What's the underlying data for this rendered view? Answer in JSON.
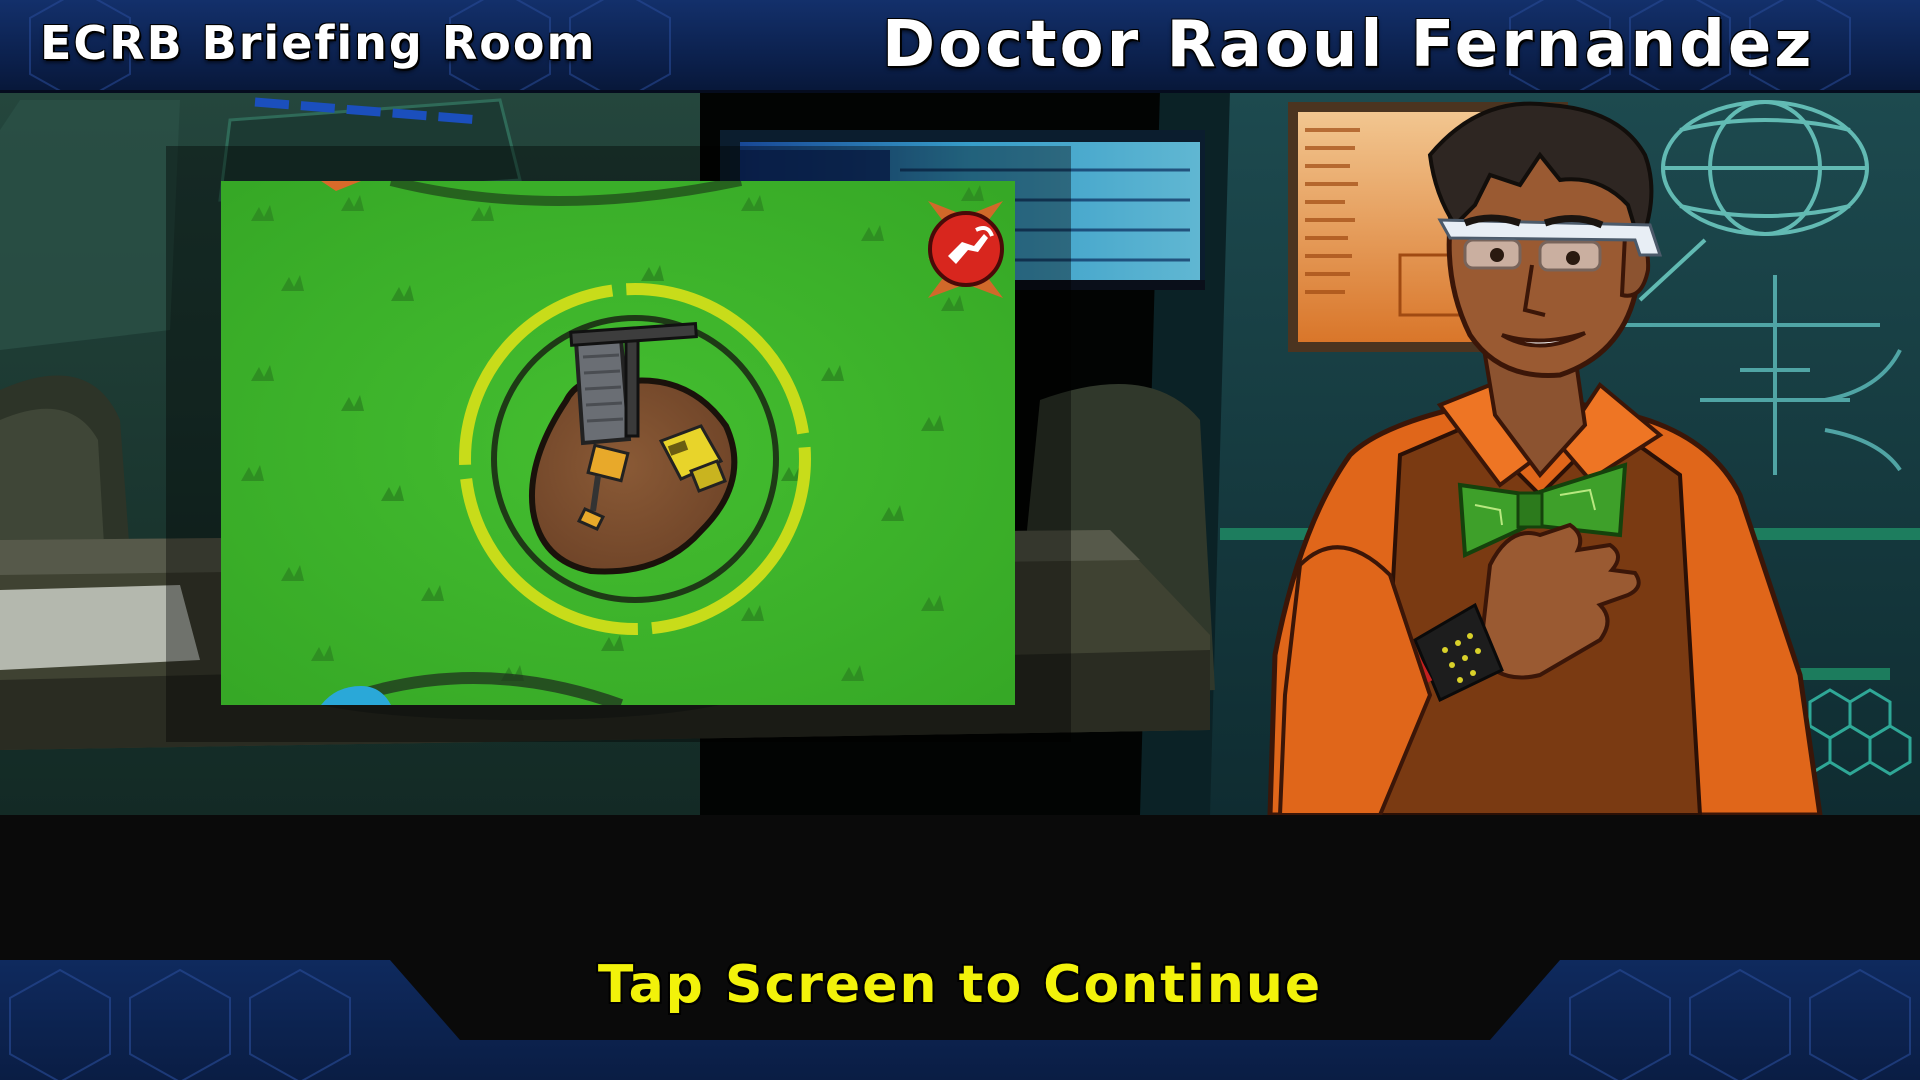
{
  "header": {
    "room_title": "ECRB Briefing Room",
    "character_name": "Doctor Raoul Fernandez"
  },
  "preview": {
    "map_icon": "fuel-pump-icon",
    "site_icon": "mine-drill-site-icon",
    "vehicles": [
      "excavator-icon",
      "dump-truck-icon"
    ]
  },
  "character": {
    "icon": "scientist-portrait"
  },
  "footer": {
    "continue_label": "Tap Screen to Continue"
  },
  "colors": {
    "accent_yellow": "#f2f20a",
    "header_blue": "#13306b",
    "grass_green": "#3fb52c",
    "shirt_orange": "#e0661a",
    "badge_red": "#d8261e"
  }
}
